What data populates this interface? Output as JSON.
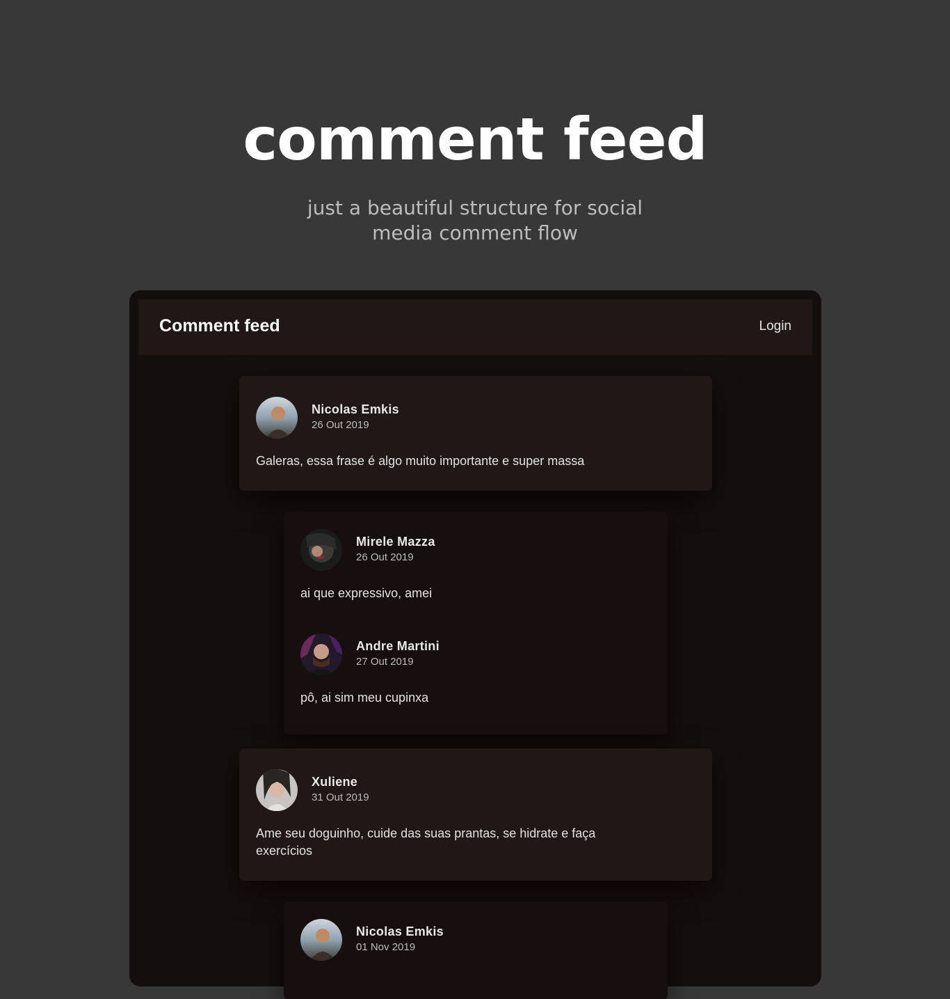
{
  "hero": {
    "title": "comment feed",
    "subtitle": "just a beautiful structure for social media comment flow"
  },
  "header": {
    "brand": "Comment feed",
    "login_label": "Login"
  },
  "comments": [
    {
      "author": "Nicolas Emkis",
      "date": "26 Out 2019",
      "text": "Galeras, essa frase é algo muito importante e super massa",
      "avatar": "nicolas-avatar",
      "replies": [
        {
          "author": "Mirele Mazza",
          "date": "26 Out 2019",
          "text": "ai que expressivo, amei",
          "avatar": "mirele-avatar"
        },
        {
          "author": "Andre Martini",
          "date": "27 Out 2019",
          "text": "pô, ai sim meu cupinxa",
          "avatar": "andre-avatar"
        }
      ]
    },
    {
      "author": "Xuliene",
      "date": "31 Out 2019",
      "text": "Ame seu doguinho, cuide das suas prantas, se hidrate e faça exercícios",
      "avatar": "xuliene-avatar",
      "replies": [
        {
          "author": "Nicolas Emkis",
          "date": "01 Nov 2019",
          "text": "",
          "avatar": "nicolas-avatar"
        }
      ]
    }
  ],
  "colors": {
    "page_bg": "#383838",
    "app_bg": "#150e0e",
    "header_bg": "#221717",
    "card_bg": "#221717",
    "reply_bg": "#170f0f"
  }
}
